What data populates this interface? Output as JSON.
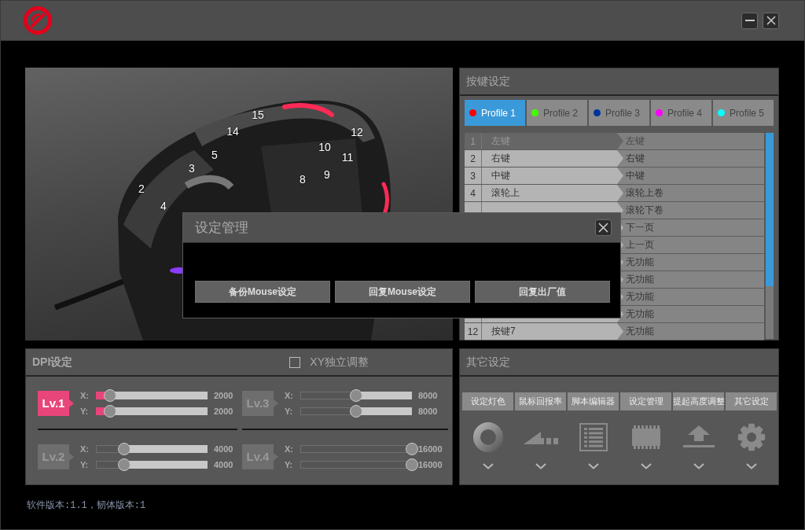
{
  "mouse_view": {
    "callouts": [
      "15",
      "14",
      "12",
      "10",
      "5",
      "11",
      "3",
      "9",
      "8",
      "2",
      "4"
    ]
  },
  "key_settings": {
    "title": "按键设定",
    "profiles": [
      {
        "label": "Profile 1",
        "color": "#ff0000",
        "selected": true
      },
      {
        "label": "Profile 2",
        "color": "#44ff00",
        "selected": false
      },
      {
        "label": "Profile 3",
        "color": "#00339c",
        "selected": false
      },
      {
        "label": "Profile 4",
        "color": "#ff00ff",
        "selected": false
      },
      {
        "label": "Profile 5",
        "color": "#00ffff",
        "selected": false
      }
    ],
    "rows": [
      {
        "number": "1",
        "button": "左键",
        "action": "左键",
        "disabled": true
      },
      {
        "number": "2",
        "button": "右键",
        "action": "右键",
        "disabled": false
      },
      {
        "number": "3",
        "button": "中键",
        "action": "中键",
        "disabled": false
      },
      {
        "number": "4",
        "button": "滚轮上",
        "action": "滚轮上卷",
        "disabled": false
      },
      {
        "action": "滚轮下卷",
        "disabled": false
      },
      {
        "action": "下一页",
        "disabled": false
      },
      {
        "action": "上一页",
        "disabled": false
      },
      {
        "action": "无功能",
        "disabled": false
      },
      {
        "action": "无功能",
        "disabled": false
      },
      {
        "action": "无功能",
        "disabled": false
      },
      {
        "action": "无功能",
        "disabled": false
      },
      {
        "number": "12",
        "button": "按键7",
        "action": "无功能",
        "disabled": false
      }
    ]
  },
  "dpi_settings": {
    "title": "DPI设定",
    "xy_independent": {
      "label": "XY独立调整",
      "checked": false
    },
    "levels": [
      {
        "label": "Lv.1",
        "selected": true,
        "axes": [
          {
            "axis": "X:",
            "level": 0.125,
            "reading": "2000"
          },
          {
            "axis": "Y:",
            "level": 0.125,
            "reading": "2000"
          }
        ]
      },
      {
        "label": "Lv.3",
        "selected": false,
        "axes": [
          {
            "axis": "X:",
            "level": 0.5,
            "reading": "8000"
          },
          {
            "axis": "Y:",
            "level": 0.5,
            "reading": "8000"
          }
        ]
      },
      {
        "label": "Lv.2",
        "selected": false,
        "axes": [
          {
            "axis": "X:",
            "level": 0.25,
            "reading": "4000"
          },
          {
            "axis": "Y:",
            "level": 0.25,
            "reading": "4000"
          }
        ]
      },
      {
        "label": "Lv.4",
        "selected": false,
        "axes": [
          {
            "axis": "X:",
            "level": 1,
            "reading": "16000"
          },
          {
            "axis": "Y:",
            "level": 1,
            "reading": "16000"
          }
        ]
      }
    ]
  },
  "other_settings": {
    "title": "其它设定",
    "tools": [
      {
        "label": "设定灯色",
        "kind": "ring"
      },
      {
        "label": "鼠标回报率",
        "kind": "ramp"
      },
      {
        "label": "脚本编辑器",
        "kind": "list"
      },
      {
        "label": "设定管理",
        "kind": "chip"
      },
      {
        "label": "提起高度调整",
        "kind": "lift"
      },
      {
        "label": "其它设定",
        "kind": "gear"
      }
    ]
  },
  "footer": {
    "version": "软件版本:1.1，韧体版本:1"
  },
  "dialog": {
    "title": "设定管理",
    "buttons": [
      "备份Mouse设定",
      "回复Mouse设定",
      "回复出厂值"
    ]
  }
}
